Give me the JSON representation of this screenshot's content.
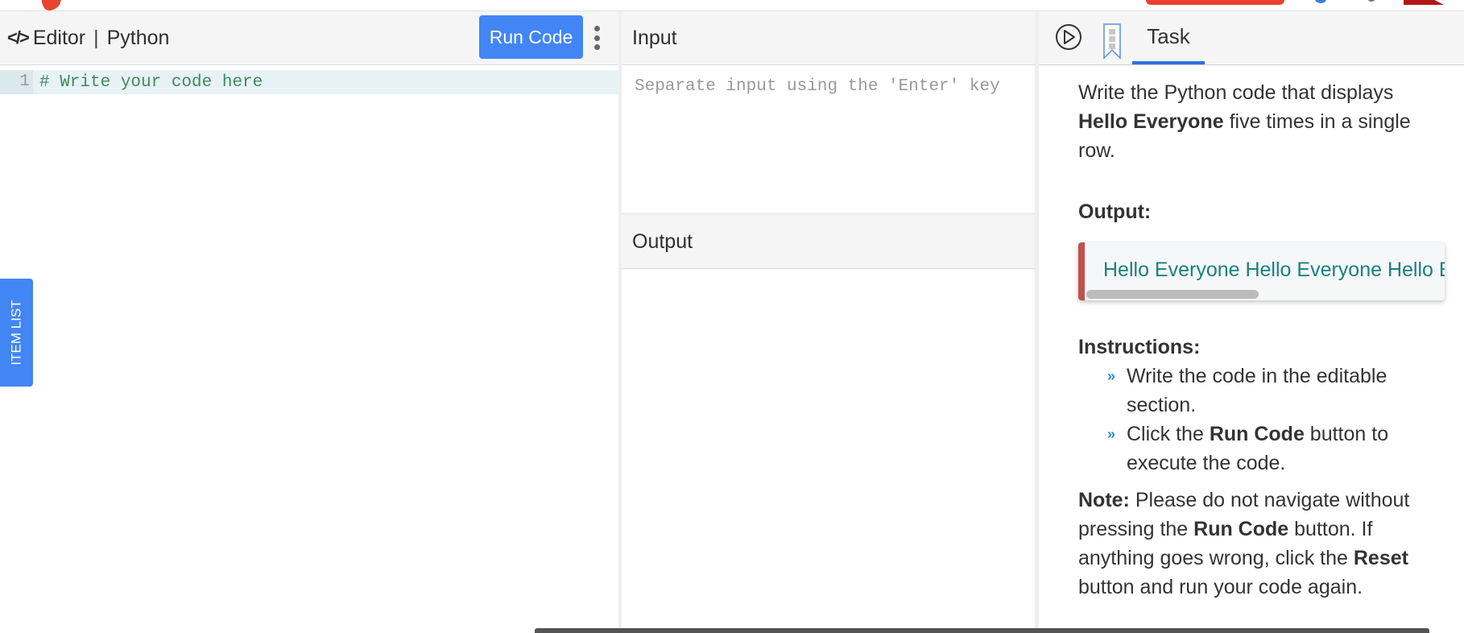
{
  "editor": {
    "title": "Editor",
    "separator": "|",
    "language": "Python",
    "code_icon": "</>",
    "run_button_label": "Run Code",
    "lines": [
      {
        "number": "1",
        "text": "# Write your code here"
      }
    ]
  },
  "item_list_tab": {
    "label": "ITEM LIST"
  },
  "io": {
    "input_label": "Input",
    "input_placeholder": "Separate input using the 'Enter' key",
    "input_value": "",
    "output_label": "Output",
    "output_value": ""
  },
  "task": {
    "tab_label": "Task",
    "description_prefix": "Write the Python code that displays ",
    "description_bold": "Hello Everyone",
    "description_suffix": " five times in a single row.",
    "output_heading": "Output:",
    "expected_output": "Hello Everyone Hello Everyone Hello Everyone Hello Everyone Hello Everyone",
    "instructions_heading": "Instructions:",
    "instructions": [
      {
        "pre": "Write the code in the editable section.",
        "bold": "",
        "post": ""
      },
      {
        "pre": "Click the ",
        "bold": "Run Code",
        "post": " button to execute the code."
      }
    ],
    "note_label": "Note:",
    "note_part1": " Please do not navigate without pressing the ",
    "note_bold1": "Run Code",
    "note_part2": " button. If anything goes wrong, click the ",
    "note_bold2": "Reset",
    "note_part3": " button and run your code again."
  },
  "colors": {
    "accent_blue": "#4285f4",
    "tab_underline": "#2f6fe0",
    "output_border": "#c0504d",
    "output_text": "#1a8080",
    "code_comment": "#3d8a5f"
  }
}
